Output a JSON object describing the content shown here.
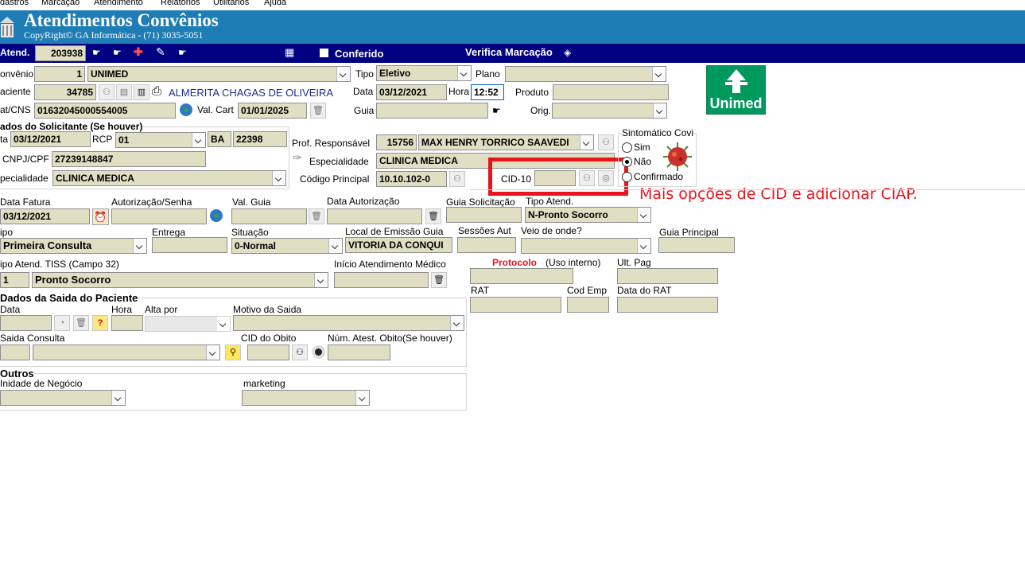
{
  "menu": [
    "dastros",
    "Marcação",
    "Atendimento",
    "Relatorios",
    "Utilitarios",
    "Ajuda"
  ],
  "header": {
    "title": "Atendimentos Convênios",
    "subtitle": "CopyRight© GA Informática - (71) 3035-5051"
  },
  "toolbar": {
    "atend_label": "Atend.",
    "atend_value": "203938",
    "conferido_label": "Conferido",
    "verifica_label": "Verifica Marcação"
  },
  "convenio": {
    "label": "onvênio",
    "code": "1",
    "name": "UNIMED"
  },
  "tipo": {
    "label": "Tipo",
    "value": "Eletivo"
  },
  "plano": {
    "label": "Plano",
    "value": ""
  },
  "paciente": {
    "label": "aciente",
    "code": "34785",
    "name": "ALMERITA CHAGAS DE OLIVEIRA"
  },
  "data": {
    "label": "Data",
    "value": "03/12/2021"
  },
  "hora": {
    "label": "Hora",
    "value": "12:52"
  },
  "produto": {
    "label": "Produto",
    "value": ""
  },
  "cns": {
    "label": "at/CNS",
    "value": "01632045000554005"
  },
  "val_cart": {
    "label": "Val. Cart",
    "value": "01/01/2025"
  },
  "guia": {
    "label": "Guia",
    "value": ""
  },
  "orig": {
    "label": "Orig.",
    "value": ""
  },
  "brand": {
    "logo_text": "Unimed",
    "color": "#00995d"
  },
  "solicitante": {
    "title": "ados do Solicitante (Se houver)",
    "data_label": "ta",
    "data_value": "03/12/2021",
    "rcp_label": "RCP",
    "rcp_value": "01",
    "uf_value": "BA",
    "num_value": "22398",
    "cnpj_label": "CNPJ/CPF",
    "cnpj_value": "27239148847",
    "esp_label": "pecialidade",
    "esp_value": "CLINICA MEDICA"
  },
  "prof": {
    "label": "Prof. Responsável",
    "code": "15756",
    "name": "MAX HENRY TORRICO SAAVEDI"
  },
  "especialidade": {
    "label": "Especialidade",
    "value": "CLINICA MEDICA"
  },
  "codigo_principal": {
    "label": "Código Principal",
    "value": "10.10.102-0"
  },
  "cid10": {
    "label": "CID-10",
    "value": ""
  },
  "sintomatico": {
    "title": "Sintomático Covi",
    "options": [
      "Sim",
      "Não",
      "Confirmado"
    ],
    "selected": "Não"
  },
  "annotation": {
    "text": "Mais opções de CID e adicionar CIAP.",
    "color": "#e8141c"
  },
  "faturamento": {
    "data_fatura_label": "Data Fatura",
    "data_fatura_value": "03/12/2021",
    "autorizacao_label": "Autorização/Senha",
    "autorizacao_value": "",
    "val_guia_label": "Val. Guia",
    "val_guia_value": "",
    "data_autorizacao_label": "Data Autorização",
    "data_autorizacao_value": "",
    "guia_solicitacao_label": "Guia Solicitação",
    "guia_solicitacao_value": "",
    "tipo_atend_label": "Tipo Atend.",
    "tipo_atend_value": "N-Pronto Socorro"
  },
  "row2": {
    "tipo_label": "ipo",
    "tipo_value": "Primeira Consulta",
    "entrega_label": "Entrega",
    "entrega_value": "",
    "situacao_label": "Situação",
    "situacao_value": "0-Normal",
    "local_label": "Local de Emissão Guia",
    "local_value": "VITORIA DA CONQUI",
    "sessoes_label": "Sessões Aut",
    "sessoes_value": "",
    "veio_label": "Veio de onde?",
    "veio_value": "",
    "guia_principal_label": "Guia Principal",
    "guia_principal_value": ""
  },
  "row3": {
    "tiss_label": "ipo Atend. TISS (Campo 32)",
    "tiss_code": "1",
    "tiss_value": "Pronto Socorro",
    "inicio_label": "Início Atendimento Médico",
    "inicio_value": "",
    "protocolo_label": "Protocolo",
    "protocolo_note": "(Uso interno)",
    "protocolo_value": "",
    "ult_pag_label": "Ult. Pag",
    "ult_pag_value": "",
    "rat_label": "RAT",
    "rat_value": "",
    "cod_emp_label": "Cod Emp",
    "cod_emp_value": "",
    "data_rat_label": "Data do RAT",
    "data_rat_value": ""
  },
  "saida": {
    "title": "Dados da Saida do Paciente",
    "data_label": "Data",
    "hora_label": "Hora",
    "alta_label": "Alta por",
    "motivo_label": "Motivo da Saida",
    "consulta_label": "Saida Consulta",
    "cid_obito_label": "CID do Obito",
    "num_atest_label": "Núm. Atest. Obito(Se houver)"
  },
  "outros": {
    "title": "Outros",
    "unidade_label": "Inidade de Negócio",
    "marketing_label": "marketing"
  }
}
